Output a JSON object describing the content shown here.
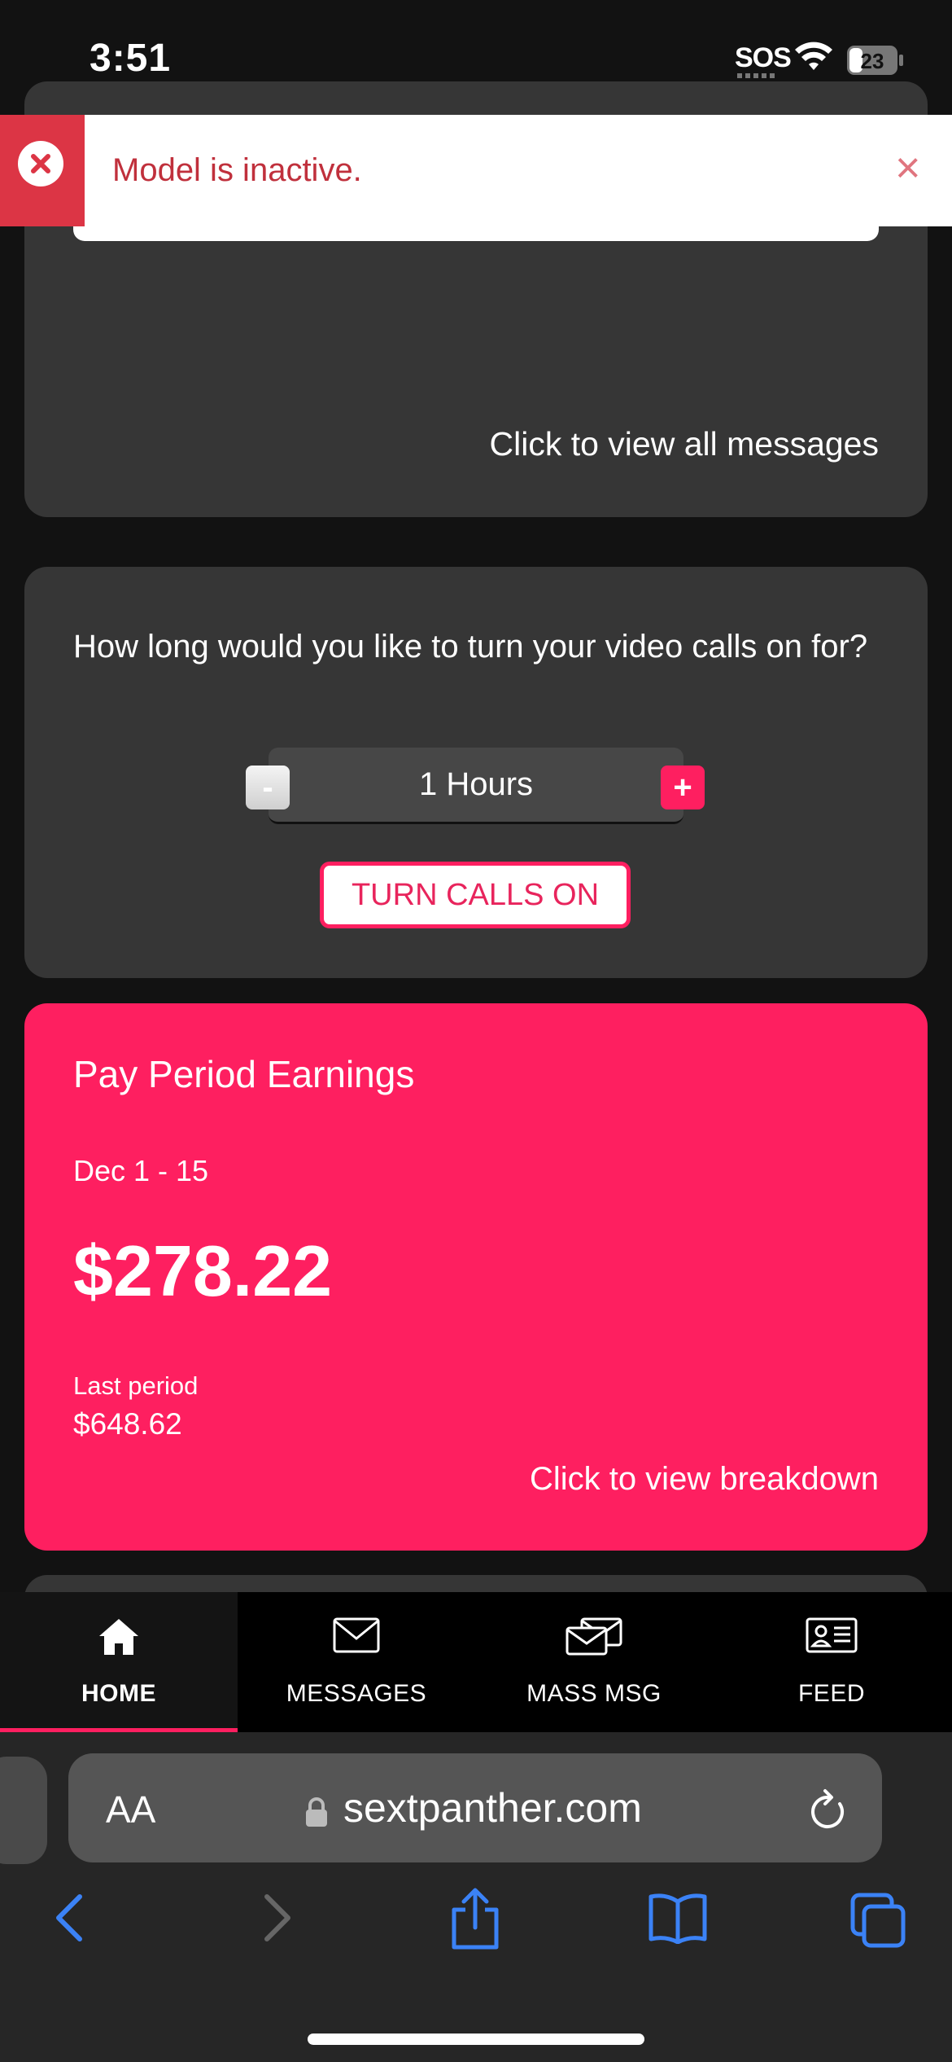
{
  "status_bar": {
    "time": "3:51",
    "sos": "SOS",
    "battery": "23"
  },
  "toast": {
    "message": "Model is inactive.",
    "close": "×",
    "icon": "error-circle-x-icon"
  },
  "messages_card": {
    "view_all": "Click to view all messages"
  },
  "calls_card": {
    "question": "How long would you like to turn your video calls on for?",
    "duration_value": "1 Hours",
    "minus_label": "-",
    "plus_label": "+",
    "button_label": "TURN CALLS ON"
  },
  "earnings_card": {
    "title": "Pay Period Earnings",
    "date_range": "Dec 1 - 15",
    "amount": "$278.22",
    "last_period_label": "Last period",
    "last_period_amount": "$648.62",
    "breakdown_link": "Click to view breakdown"
  },
  "nav": {
    "tabs": [
      {
        "label": "HOME",
        "icon": "home-icon",
        "active": true
      },
      {
        "label": "MESSAGES",
        "icon": "envelope-icon",
        "active": false
      },
      {
        "label": "MASS MSG",
        "icon": "envelopes-icon",
        "active": false
      },
      {
        "label": "FEED",
        "icon": "id-card-icon",
        "active": false
      }
    ]
  },
  "browser": {
    "text_size": "AA",
    "url": "sextpanther.com"
  },
  "colors": {
    "accent": "#fe1f60",
    "background": "#121212",
    "card": "#363636",
    "toast_error": "#dc3545",
    "browser_blue": "#3b82f6"
  }
}
